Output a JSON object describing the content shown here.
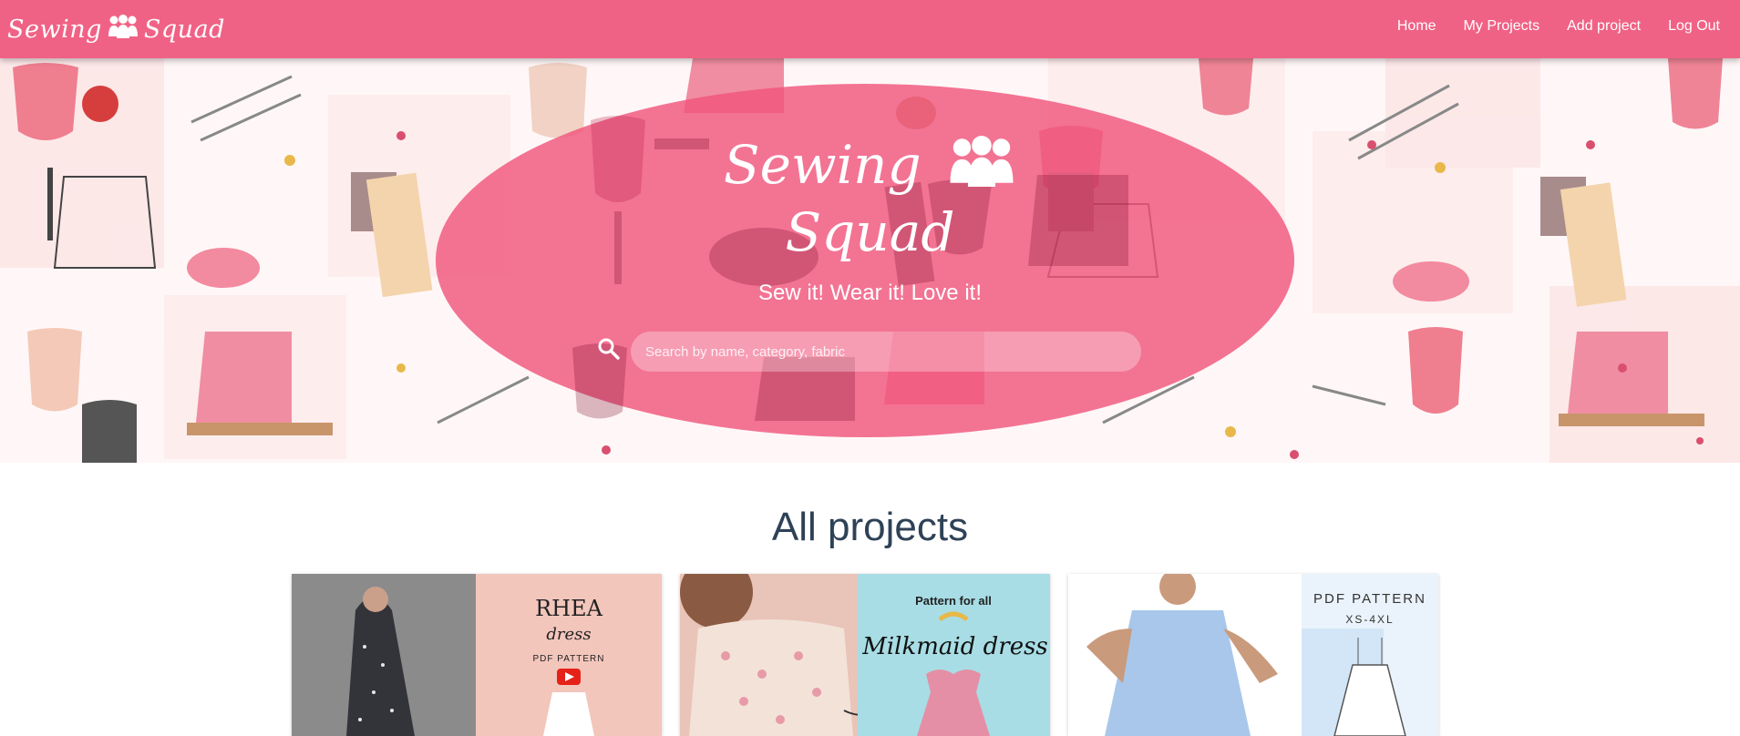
{
  "navbar": {
    "brand_left": "Sewing",
    "brand_right": "Squad",
    "links": [
      {
        "label": "Home"
      },
      {
        "label": "My Projects"
      },
      {
        "label": "Add project"
      },
      {
        "label": "Log Out"
      }
    ]
  },
  "hero": {
    "title_line1": "Sewing",
    "title_line2": "Squad",
    "tagline": "Sew it! Wear it! Love it!",
    "search": {
      "placeholder": "Search by name, category, fabric",
      "value": ""
    }
  },
  "projects": {
    "title": "All projects",
    "cards": [
      {
        "line1": "RHEA",
        "line2": "dress",
        "line3": "PDF PATTERN"
      },
      {
        "line1": "Pattern for all",
        "line2": "Milkmaid dress"
      },
      {
        "line1": "PDF PATTERN",
        "line2": "XS-4XL"
      }
    ]
  },
  "icons": {
    "brand": "people-group-icon",
    "search": "search-icon",
    "video": "youtube-icon"
  },
  "colors": {
    "primary": "#f06285",
    "oval": "#f0567c",
    "heading": "#2e4257",
    "background": "#ffffff"
  }
}
